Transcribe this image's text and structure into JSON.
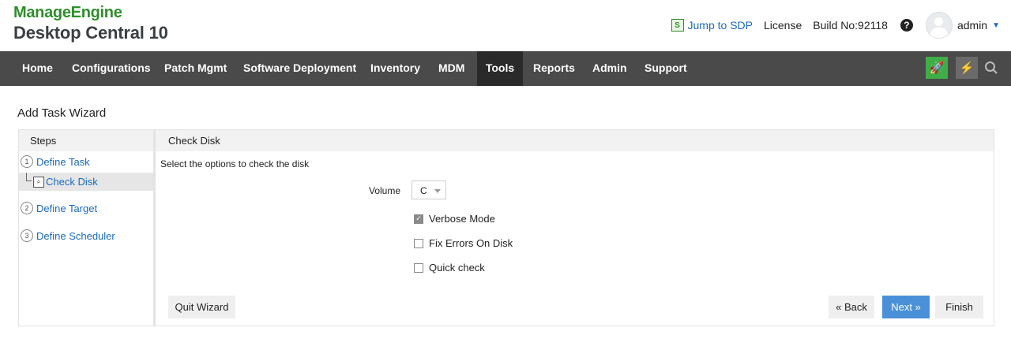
{
  "header": {
    "brand": "ManageEngine",
    "product": "Desktop Central 10",
    "jump_to_sdp": "Jump to SDP",
    "license": "License",
    "build": "Build No:92118",
    "help_glyph": "?",
    "user": "admin"
  },
  "nav": {
    "items": [
      {
        "label": "Home"
      },
      {
        "label": "Configurations"
      },
      {
        "label": "Patch Mgmt"
      },
      {
        "label": "Software Deployment"
      },
      {
        "label": "Inventory"
      },
      {
        "label": "MDM"
      },
      {
        "label": "Tools"
      },
      {
        "label": "Reports"
      },
      {
        "label": "Admin"
      },
      {
        "label": "Support"
      }
    ],
    "active": "Tools",
    "icons": [
      "rocket-icon",
      "bolt-icon",
      "search-icon"
    ]
  },
  "wizard": {
    "title": "Add Task Wizard",
    "steps_header": "Steps",
    "steps": [
      {
        "num": "1",
        "label": "Define Task"
      },
      {
        "label": "Check Disk"
      },
      {
        "num": "2",
        "label": "Define Target"
      },
      {
        "num": "3",
        "label": "Define Scheduler"
      }
    ],
    "content_header": "Check Disk",
    "description": "Select the options to check the disk",
    "volume_label": "Volume",
    "volume_value": "C",
    "options": [
      {
        "label": "Verbose Mode",
        "checked": true
      },
      {
        "label": "Fix Errors On Disk",
        "checked": false
      },
      {
        "label": "Quick check",
        "checked": false
      }
    ],
    "buttons": {
      "quit": "Quit Wizard",
      "back": "« Back",
      "next": "Next »",
      "finish": "Finish"
    }
  },
  "colors": {
    "brand_green": "#2f8f2a",
    "nav_bg": "#4a4a4a",
    "link_blue": "#1a6bbf",
    "primary_button": "#4a90d9"
  }
}
